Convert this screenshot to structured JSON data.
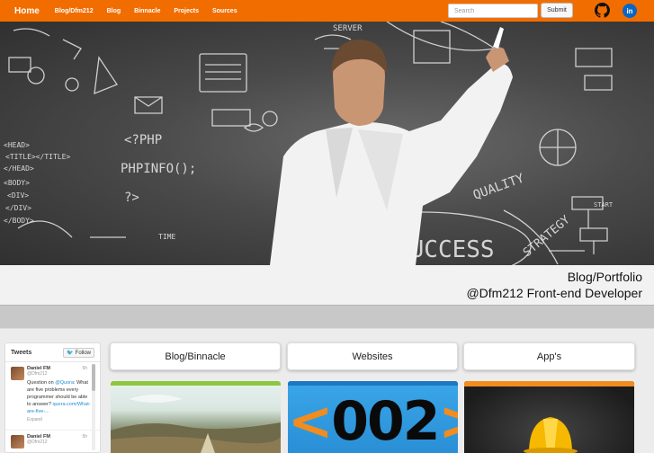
{
  "navbar": {
    "brand": "Home",
    "links": [
      "Blog/Dfm212",
      "Blog",
      "Binnacle",
      "Projects",
      "Sources"
    ],
    "search_placeholder": "Search",
    "submit_label": "Submit",
    "linkedin_label": "in"
  },
  "hero": {
    "chalk_texts": [
      "<?PHP",
      "PHPINFO();",
      "<HEAD>",
      "<TITLE></TITLE>",
      "</HEAD>",
      "<BODY>",
      "<DIV>",
      "</DIV>",
      "</BODY>",
      "?>",
      "SUCCESS",
      "QUALITY",
      "STRATEGY",
      "START",
      "SERVER",
      "TIME"
    ]
  },
  "caption": {
    "line1": "Blog/Portfolio",
    "line2": "@Dfm212 Front-end Developer"
  },
  "tweets": {
    "title": "Tweets",
    "follow_label": "Follow",
    "items": [
      {
        "name": "Daniel FM",
        "handle": "@Dfm212",
        "time": "5h",
        "text_prefix": "Question on ",
        "mention": "@Quora",
        "text_body": ": What are five problems every programmer should be able to answer?",
        "link": "quora.com/What-are-five-...",
        "expand": "Expand"
      },
      {
        "name": "Daniel FM",
        "handle": "@Dfm212",
        "time": "5h",
        "text_prefix": "",
        "mention": "",
        "text_body": "",
        "link": "",
        "expand": ""
      }
    ]
  },
  "cards": [
    {
      "label": "Blog/Binnacle"
    },
    {
      "label": "Websites",
      "thumb_text": "<002>"
    },
    {
      "label": "App's"
    }
  ],
  "colors": {
    "navbar": "#f26d00",
    "linkedin": "#0a66c2",
    "twitter": "#1da1f2"
  }
}
